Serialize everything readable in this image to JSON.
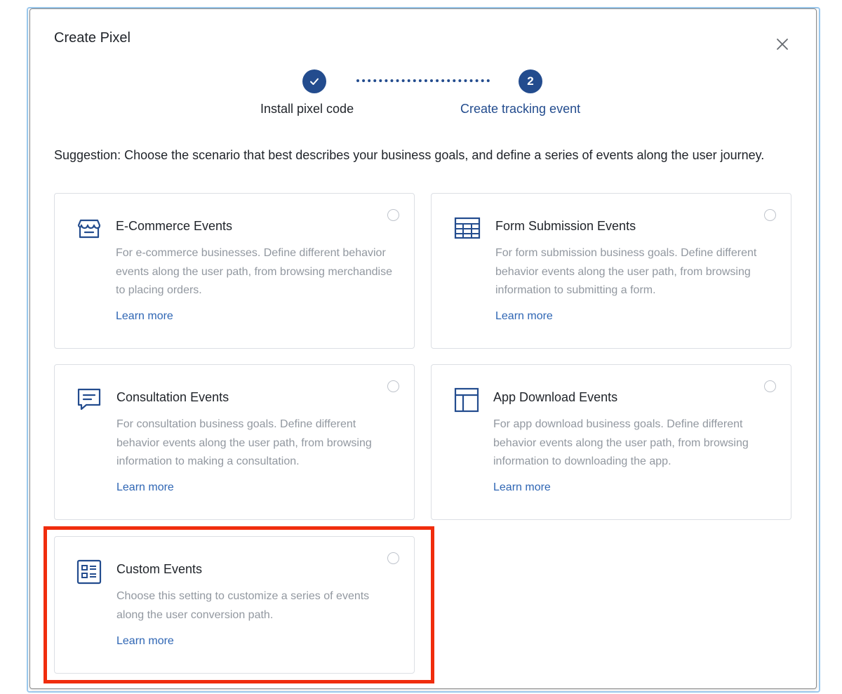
{
  "dialog": {
    "title": "Create Pixel",
    "close_icon": "close-icon"
  },
  "steps": [
    {
      "icon": "check-icon",
      "label": "Install pixel code",
      "state": "completed"
    },
    {
      "number": "2",
      "label": "Create tracking event",
      "state": "active"
    }
  ],
  "suggestion": "Suggestion: Choose the scenario that best describes your business goals, and define a series of events along the user journey.",
  "cards": [
    {
      "icon": "storefront-icon",
      "title": "E-Commerce Events",
      "description": "For e-commerce businesses. Define different behavior events along the user path, from browsing merchandise to placing orders.",
      "link": "Learn more",
      "selected": false
    },
    {
      "icon": "form-grid-icon",
      "title": "Form Submission Events",
      "description": "For form submission business goals. Define different behavior events along the user path, from browsing information to submitting a form.",
      "link": "Learn more",
      "selected": false
    },
    {
      "icon": "chat-bubble-icon",
      "title": "Consultation Events",
      "description": "For consultation business goals. Define different behavior events along the user path, from browsing information to making a consultation.",
      "link": "Learn more",
      "selected": false
    },
    {
      "icon": "app-layout-icon",
      "title": "App Download Events",
      "description": "For app download business goals. Define different behavior events along the user path, from browsing information to downloading the app.",
      "link": "Learn more",
      "selected": false
    },
    {
      "icon": "custom-list-icon",
      "title": "Custom Events",
      "description": "Choose this setting to customize a series of events along the user conversion path.",
      "link": "Learn more",
      "selected": false
    }
  ],
  "colors": {
    "accent": "#234c8e",
    "link": "#2f66b4",
    "highlight": "#f02d0d",
    "muted_text": "#9298a0"
  }
}
